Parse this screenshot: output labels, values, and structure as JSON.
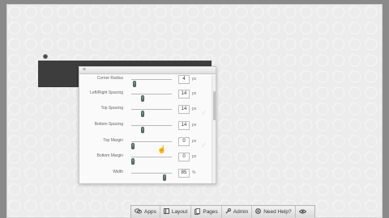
{
  "panel": {
    "close_glyph": "×",
    "rows": [
      {
        "label": "Corner Radius",
        "value": "4",
        "unit": "px",
        "slider_fraction": 0.05
      },
      {
        "label": "Left/Right Spacing",
        "value": "14",
        "unit": "px",
        "slider_fraction": 0.25
      },
      {
        "label": "Top Spacing",
        "value": "14",
        "unit": "px",
        "slider_fraction": 0.25
      },
      {
        "label": "Bottom Spacing",
        "value": "14",
        "unit": "px",
        "slider_fraction": 0.25
      },
      {
        "label": "Top Margin",
        "value": "0",
        "unit": "px",
        "slider_fraction": 0.0
      },
      {
        "label": "Bottom Margin",
        "value": "0",
        "unit": "px",
        "slider_fraction": 0.0
      },
      {
        "label": "Width",
        "value": "85",
        "unit": "%",
        "slider_fraction": 0.85
      }
    ]
  },
  "taskbar": {
    "items": [
      {
        "label": "Apps",
        "icon": "chat-bubbles-icon"
      },
      {
        "label": "Layout",
        "icon": "layout-icon"
      },
      {
        "label": "Pages",
        "icon": "pages-icon"
      },
      {
        "label": "Admin",
        "icon": "wrench-icon"
      },
      {
        "label": "Need Help?",
        "icon": "help-icon"
      },
      {
        "label": "",
        "icon": "eye-icon"
      }
    ]
  },
  "colors": {
    "background": "#8a8a8a",
    "canvas": "#ececec",
    "dark_block": "#3d3d3d",
    "slider_knob": "#5f7a6e"
  }
}
